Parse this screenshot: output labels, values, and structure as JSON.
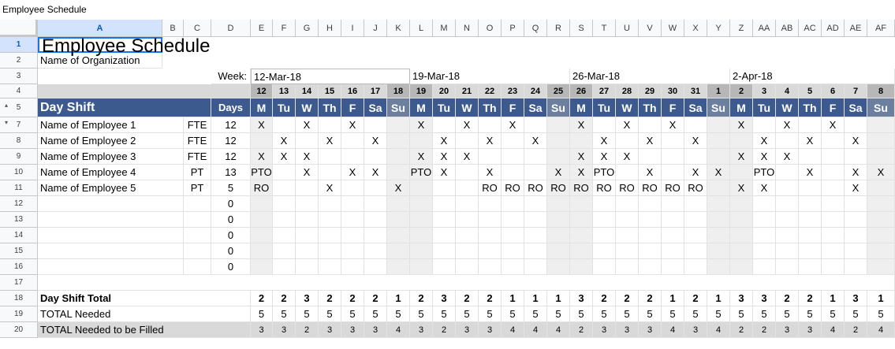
{
  "window_title": "Employee Schedule",
  "col_letters": [
    "A",
    "B",
    "C",
    "D",
    "E",
    "F",
    "G",
    "H",
    "I",
    "J",
    "K",
    "L",
    "M",
    "N",
    "O",
    "P",
    "Q",
    "R",
    "S",
    "T",
    "U",
    "V",
    "W",
    "X",
    "Y",
    "Z",
    "AA",
    "AB",
    "AC",
    "AD",
    "AE",
    "AF"
  ],
  "row_numbers": [
    "1",
    "2",
    "3",
    "4",
    "5",
    "7",
    "8",
    "9",
    "10",
    "11",
    "12",
    "13",
    "14",
    "15",
    "16",
    "17",
    "18",
    "19",
    "20"
  ],
  "title": "Employee Schedule",
  "organization": "Name of Organization",
  "week_label": "Week:",
  "week_dates": [
    "12-Mar-18",
    "19-Mar-18",
    "26-Mar-18",
    "2-Apr-18"
  ],
  "day_numbers": [
    "12",
    "13",
    "14",
    "15",
    "16",
    "17",
    "18",
    "19",
    "20",
    "21",
    "22",
    "23",
    "24",
    "25",
    "26",
    "27",
    "28",
    "29",
    "30",
    "31",
    "1",
    "2",
    "3",
    "4",
    "5",
    "6",
    "7",
    "8"
  ],
  "day_letters": [
    "M",
    "Tu",
    "W",
    "Th",
    "F",
    "Sa",
    "Su",
    "M",
    "Tu",
    "W",
    "Th",
    "F",
    "Sa",
    "Su",
    "M",
    "Tu",
    "W",
    "Th",
    "F",
    "Sa",
    "Su",
    "M",
    "Tu",
    "W",
    "Th",
    "F",
    "Sa",
    "Su"
  ],
  "header": {
    "shift": "Day Shift",
    "days": "Days"
  },
  "employees": [
    {
      "name": "Name of Employee 1",
      "type": "FTE",
      "days": "12",
      "marks": [
        "X",
        "",
        "X",
        "",
        "X",
        "",
        "",
        "X",
        "",
        "X",
        "",
        "X",
        "",
        "",
        "X",
        "",
        "X",
        "",
        "X",
        "",
        "",
        "X",
        "",
        "X",
        "",
        "X",
        "",
        ""
      ]
    },
    {
      "name": "Name of Employee 2",
      "type": "FTE",
      "days": "12",
      "marks": [
        "",
        "X",
        "",
        "X",
        "",
        "X",
        "",
        "",
        "X",
        "",
        "X",
        "",
        "X",
        "",
        "",
        "X",
        "",
        "X",
        "",
        "X",
        "",
        "",
        "X",
        "",
        "X",
        "",
        "X",
        ""
      ]
    },
    {
      "name": "Name of Employee 3",
      "type": "FTE",
      "days": "12",
      "marks": [
        "X",
        "X",
        "X",
        "",
        "",
        "",
        "",
        "X",
        "X",
        "X",
        "",
        "",
        "",
        "",
        "X",
        "X",
        "X",
        "",
        "",
        "",
        "",
        "X",
        "X",
        "X",
        "",
        "",
        "",
        ""
      ]
    },
    {
      "name": "Name of Employee 4",
      "type": "PT",
      "days": "13",
      "marks": [
        "PTO",
        "",
        "X",
        "",
        "X",
        "X",
        "",
        "PTO",
        "X",
        "",
        "X",
        "",
        "",
        "X",
        "X",
        "PTO",
        "",
        "X",
        "",
        "X",
        "X",
        "",
        "PTO",
        "",
        "X",
        "",
        "X",
        "X"
      ]
    },
    {
      "name": "Name of Employee 5",
      "type": "PT",
      "days": "5",
      "marks": [
        "RO",
        "",
        "",
        "X",
        "",
        "",
        "X",
        "",
        "",
        "",
        "RO",
        "RO",
        "RO",
        "RO",
        "RO",
        "RO",
        "RO",
        "RO",
        "RO",
        "RO",
        "",
        "X",
        "X",
        "",
        "",
        "",
        "X",
        ""
      ]
    }
  ],
  "empty_days": [
    "0",
    "0",
    "0",
    "0",
    "0"
  ],
  "totals": {
    "shift_total_label": "Day Shift Total",
    "shift_total": [
      "2",
      "2",
      "3",
      "2",
      "2",
      "2",
      "1",
      "2",
      "3",
      "2",
      "2",
      "1",
      "1",
      "1",
      "3",
      "2",
      "2",
      "2",
      "1",
      "2",
      "1",
      "3",
      "3",
      "2",
      "2",
      "1",
      "3",
      "1"
    ],
    "needed_label": "TOTAL Needed",
    "needed": [
      "5",
      "5",
      "5",
      "5",
      "5",
      "5",
      "5",
      "5",
      "5",
      "5",
      "5",
      "5",
      "5",
      "5",
      "5",
      "5",
      "5",
      "5",
      "5",
      "5",
      "5",
      "5",
      "5",
      "5",
      "5",
      "5",
      "5",
      "5"
    ],
    "to_fill_label": "TOTAL Needed to be Filled",
    "to_fill": [
      "3",
      "3",
      "2",
      "3",
      "3",
      "3",
      "4",
      "3",
      "2",
      "3",
      "3",
      "4",
      "4",
      "4",
      "2",
      "3",
      "3",
      "3",
      "4",
      "3",
      "4",
      "2",
      "2",
      "3",
      "3",
      "4",
      "2",
      "4"
    ]
  },
  "colors": {
    "header_blue": "#3d5a8f",
    "sunday_blue": "#6d7f9e",
    "weekend_gray": "#efefef",
    "selection": "#1a73e8"
  }
}
